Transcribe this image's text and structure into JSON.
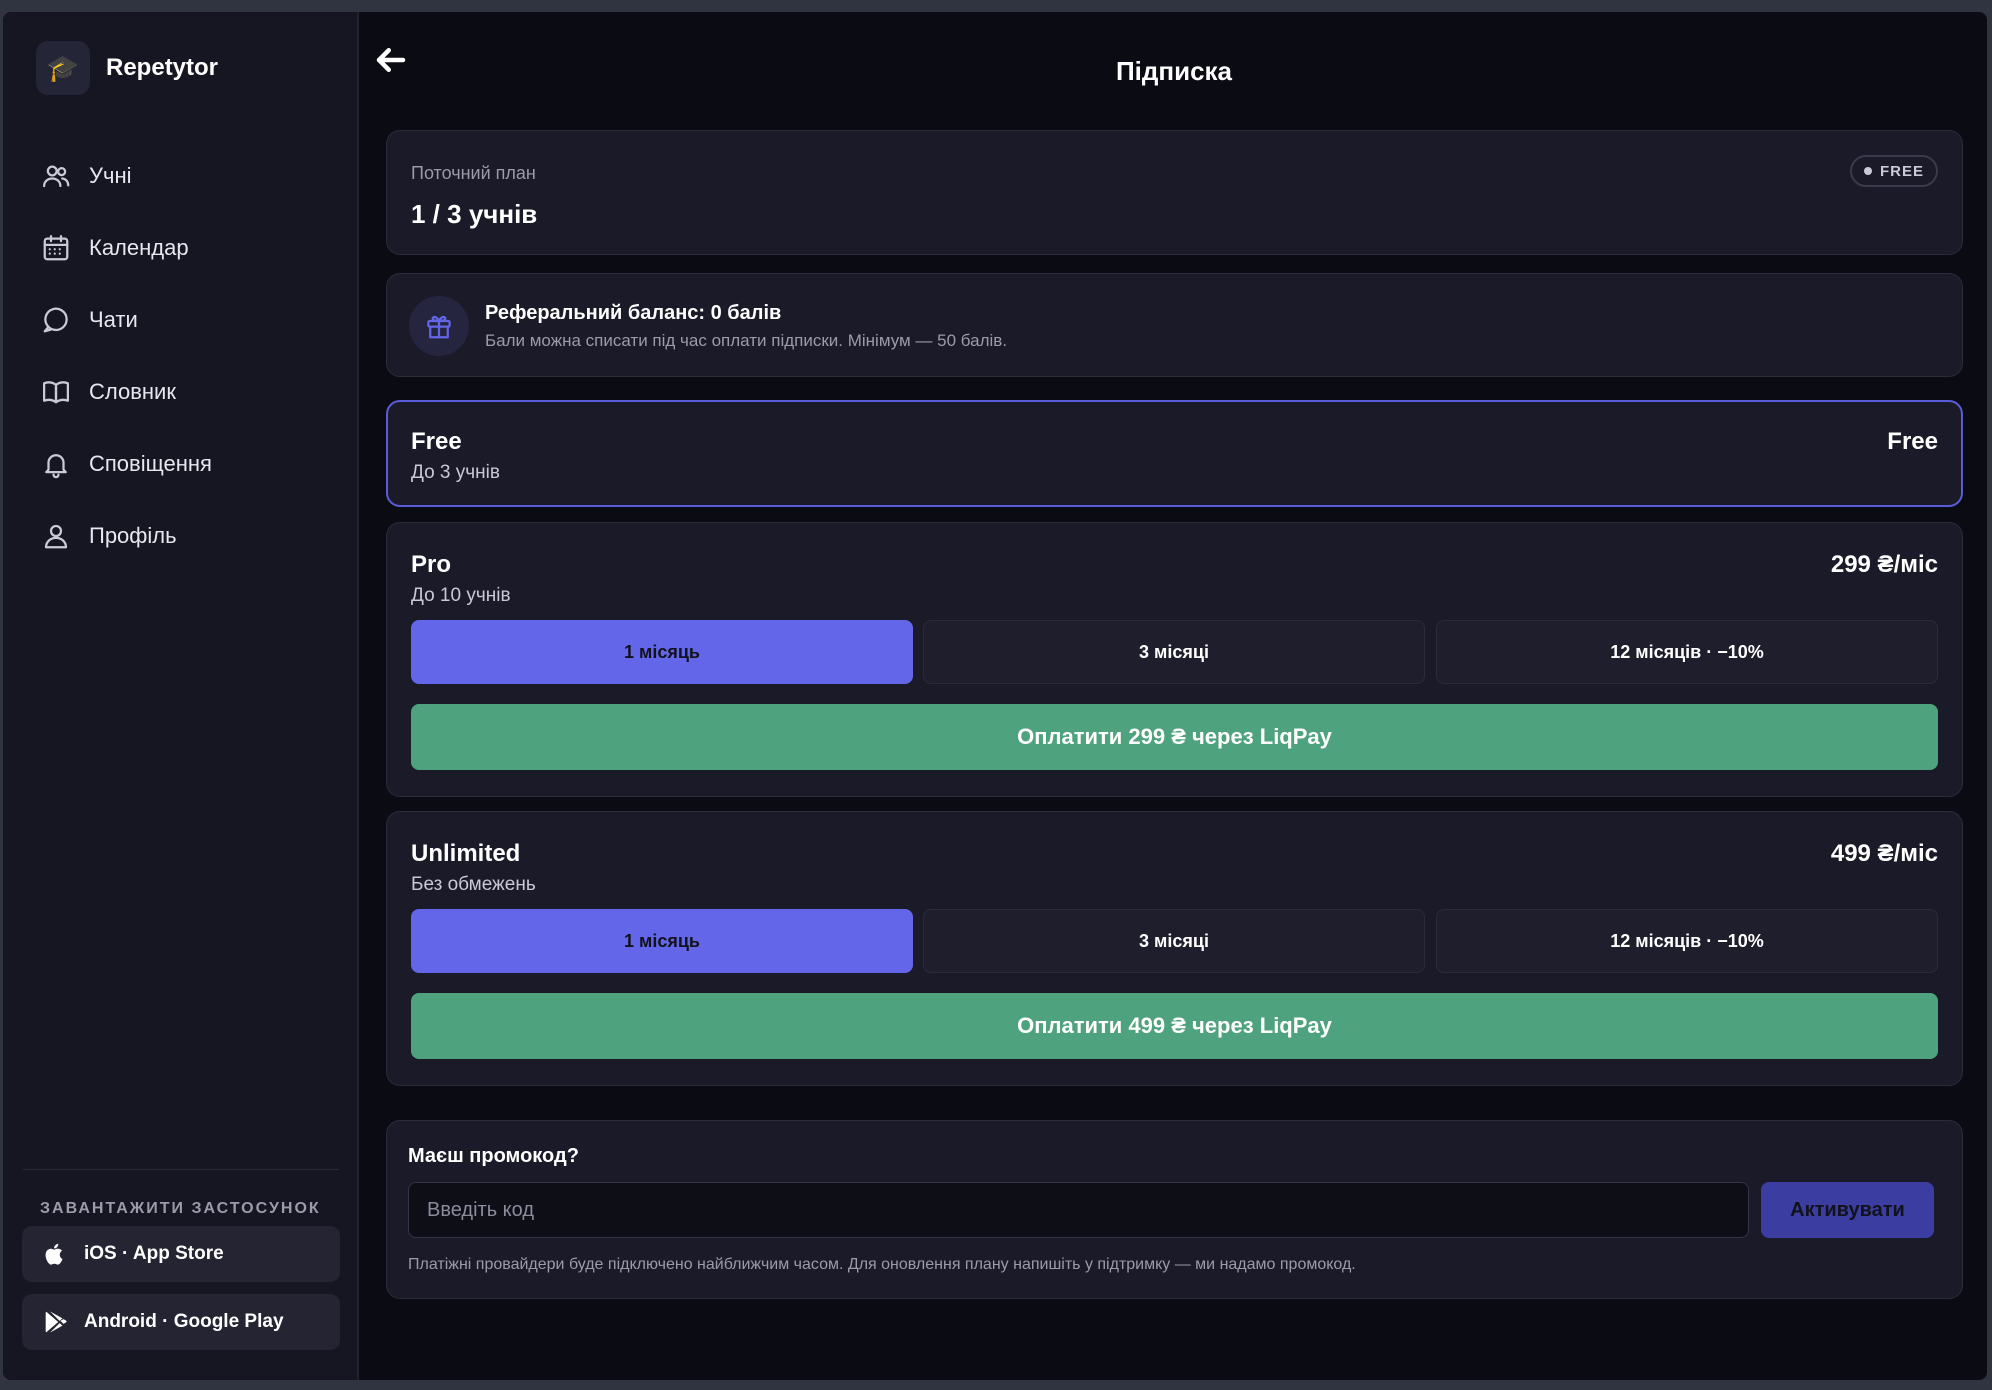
{
  "app": {
    "name": "Repetytor",
    "logo_emoji": "🎓"
  },
  "sidebar": {
    "items": [
      {
        "label": "Учні",
        "icon": "users-icon"
      },
      {
        "label": "Календар",
        "icon": "calendar-icon"
      },
      {
        "label": "Чати",
        "icon": "chat-icon"
      },
      {
        "label": "Словник",
        "icon": "book-icon"
      },
      {
        "label": "Сповіщення",
        "icon": "bell-icon"
      },
      {
        "label": "Профіль",
        "icon": "user-icon"
      }
    ],
    "download_heading": "ЗАВАНТАЖИТИ ЗАСТОСУНОК",
    "ios_label": "iOS · App Store",
    "android_label": "Android · Google Play"
  },
  "header": {
    "title": "Підписка"
  },
  "current_plan": {
    "label": "Поточний план",
    "value": "1 / 3 учнів",
    "badge": "FREE"
  },
  "referral": {
    "title": "Реферальний баланс: 0 балів",
    "description": "Бали можна списати під час оплати підписки. Мінімум — 50 балів."
  },
  "plans": [
    {
      "name": "Free",
      "subtitle": "До 3 учнів",
      "price": "Free",
      "selected": true
    },
    {
      "name": "Pro",
      "subtitle": "До 10 учнів",
      "price": "299 ₴/міс",
      "periods": [
        "1 місяць",
        "3 місяці",
        "12 місяців · −10%"
      ],
      "active_period": 0,
      "pay_label": "Оплатити 299 ₴ через  LiqPay"
    },
    {
      "name": "Unlimited",
      "subtitle": "Без обмежень",
      "price": "499 ₴/міс",
      "periods": [
        "1 місяць",
        "3 місяці",
        "12 місяців · −10%"
      ],
      "active_period": 0,
      "pay_label": "Оплатити 499 ₴ через  LiqPay"
    }
  ],
  "promo": {
    "title": "Маєш промокод?",
    "placeholder": "Введіть код",
    "value": "",
    "button_label": "Активувати",
    "note": "Платіжні провайдери буде підключено найближчим часом. Для оновлення плану напишіть у підтримку — ми надамо промокод."
  },
  "colors": {
    "accent": "#6366e8",
    "pay_green": "#4ea37e",
    "background": "#0b0b13",
    "card": "#1a1a28"
  }
}
